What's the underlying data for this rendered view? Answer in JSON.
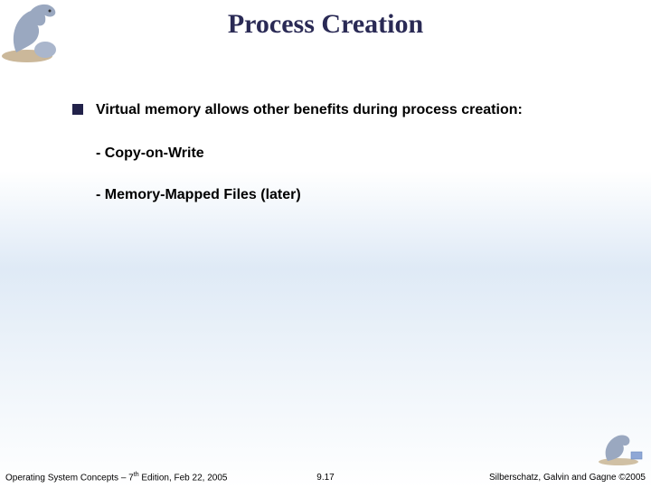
{
  "title": "Process Creation",
  "bullet_main": "Virtual memory allows other benefits during process creation:",
  "sub1": "- Copy-on-Write",
  "sub2": "- Memory-Mapped Files (later)",
  "footer": {
    "left_pre": "Operating System Concepts – 7",
    "left_sup": "th",
    "left_post": " Edition, Feb 22, 2005",
    "center": "9.17",
    "right": "Silberschatz, Galvin and Gagne ©2005"
  }
}
